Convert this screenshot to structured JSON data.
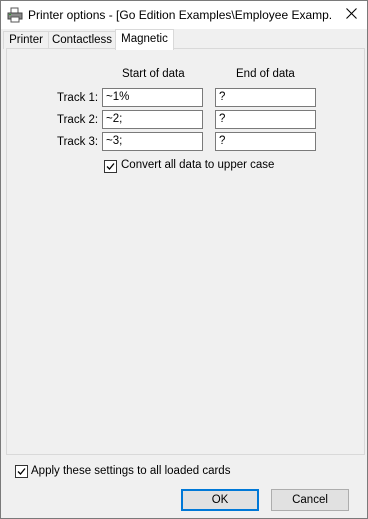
{
  "window": {
    "title": "Printer options - [Go Edition Examples\\Employee Examp...",
    "app_icon": "printer-icon",
    "close_icon": "close-icon"
  },
  "tabs": [
    {
      "label": "Printer",
      "active": false
    },
    {
      "label": "Contactless",
      "active": false
    },
    {
      "label": "Magnetic",
      "active": true
    }
  ],
  "magnetic": {
    "start_header": "Start of data",
    "end_header": "End of data",
    "tracks": [
      {
        "label": "Track 1:",
        "start": "~1%",
        "end": "?"
      },
      {
        "label": "Track 2:",
        "start": "~2;",
        "end": "?"
      },
      {
        "label": "Track 3:",
        "start": "~3;",
        "end": "?"
      }
    ],
    "uppercase": {
      "label": "Convert all data to upper case",
      "checked": true
    }
  },
  "footer": {
    "apply_all": {
      "label": "Apply these settings to all loaded cards",
      "checked": true
    },
    "ok_label": "OK",
    "cancel_label": "Cancel"
  }
}
